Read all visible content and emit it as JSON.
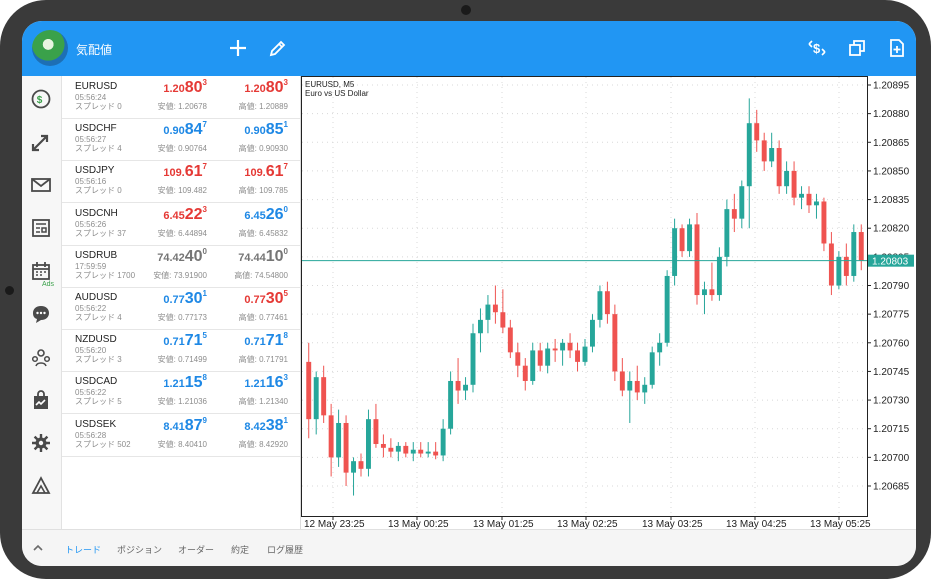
{
  "header": {
    "title": "気配値"
  },
  "quotes": [
    {
      "symbol": "EURUSD",
      "time": "05:56:24",
      "spread": "スプレッド 0",
      "bid": {
        "small": "1.20",
        "big": "80",
        "sup": "3",
        "color": "#e53935"
      },
      "ask": {
        "small": "1.20",
        "big": "80",
        "sup": "3",
        "color": "#e53935"
      },
      "low": "安値: 1.20678",
      "high": "高値: 1.20889"
    },
    {
      "symbol": "USDCHF",
      "time": "05:56:27",
      "spread": "スプレッド 4",
      "bid": {
        "small": "0.90",
        "big": "84",
        "sup": "7",
        "color": "#1e88e5"
      },
      "ask": {
        "small": "0.90",
        "big": "85",
        "sup": "1",
        "color": "#1e88e5"
      },
      "low": "安値: 0.90764",
      "high": "高値: 0.90930"
    },
    {
      "symbol": "USDJPY",
      "time": "05:56:16",
      "spread": "スプレッド 0",
      "bid": {
        "small": "109.",
        "big": "61",
        "sup": "7",
        "color": "#e53935"
      },
      "ask": {
        "small": "109.",
        "big": "61",
        "sup": "7",
        "color": "#e53935"
      },
      "low": "安値: 109.482",
      "high": "高値: 109.785"
    },
    {
      "symbol": "USDCNH",
      "time": "05:56:26",
      "spread": "スプレッド 37",
      "bid": {
        "small": "6.45",
        "big": "22",
        "sup": "3",
        "color": "#e53935"
      },
      "ask": {
        "small": "6.45",
        "big": "26",
        "sup": "0",
        "color": "#1e88e5"
      },
      "low": "安値: 6.44894",
      "high": "高値: 6.45832"
    },
    {
      "symbol": "USDRUB",
      "time": "17:59:59",
      "spread": "スプレッド 1700",
      "bid": {
        "small": "74.42",
        "big": "40",
        "sup": "0",
        "color": "#757575"
      },
      "ask": {
        "small": "74.44",
        "big": "10",
        "sup": "0",
        "color": "#757575"
      },
      "low": "安値: 73.91900",
      "high": "高値: 74.54800"
    },
    {
      "symbol": "AUDUSD",
      "time": "05:56:22",
      "spread": "スプレッド 4",
      "bid": {
        "small": "0.77",
        "big": "30",
        "sup": "1",
        "color": "#1e88e5"
      },
      "ask": {
        "small": "0.77",
        "big": "30",
        "sup": "5",
        "color": "#e53935"
      },
      "low": "安値: 0.77173",
      "high": "高値: 0.77461"
    },
    {
      "symbol": "NZDUSD",
      "time": "05:56:20",
      "spread": "スプレッド 3",
      "bid": {
        "small": "0.71",
        "big": "71",
        "sup": "5",
        "color": "#1e88e5"
      },
      "ask": {
        "small": "0.71",
        "big": "71",
        "sup": "8",
        "color": "#1e88e5"
      },
      "low": "安値: 0.71499",
      "high": "高値: 0.71791"
    },
    {
      "symbol": "USDCAD",
      "time": "05:56:22",
      "spread": "スプレッド 5",
      "bid": {
        "small": "1.21",
        "big": "15",
        "sup": "8",
        "color": "#1e88e5"
      },
      "ask": {
        "small": "1.21",
        "big": "16",
        "sup": "3",
        "color": "#1e88e5"
      },
      "low": "安値: 1.21036",
      "high": "高値: 1.21340"
    },
    {
      "symbol": "USDSEK",
      "time": "05:56:28",
      "spread": "スプレッド 502",
      "bid": {
        "small": "8.41",
        "big": "87",
        "sup": "9",
        "color": "#1e88e5"
      },
      "ask": {
        "small": "8.42",
        "big": "38",
        "sup": "1",
        "color": "#1e88e5"
      },
      "low": "安値: 8.40410",
      "high": "高値: 8.42920"
    }
  ],
  "rail": {
    "ads_label": "Ads"
  },
  "chart": {
    "symbol_label": "EURUSD, M5",
    "description": "Euro vs US Dollar",
    "price_labels": [
      "1.20895",
      "1.20880",
      "1.20865",
      "1.20850",
      "1.20835",
      "1.20820",
      "1.20805",
      "1.20790",
      "1.20775",
      "1.20760",
      "1.20745",
      "1.20730",
      "1.20715",
      "1.20700",
      "1.20685"
    ],
    "time_labels": [
      "12 May 23:25",
      "13 May 00:25",
      "13 May 01:25",
      "13 May 02:25",
      "13 May 03:25",
      "13 May 04:25",
      "13 May 05:25"
    ],
    "current_price": "1.20803",
    "bull_color": "#26a69a",
    "bear_color": "#ef5350",
    "candles": [
      [
        1.2075,
        1.2076,
        1.2071,
        1.2072
      ],
      [
        1.2072,
        1.20745,
        1.20712,
        1.20742
      ],
      [
        1.20742,
        1.20748,
        1.20718,
        1.20722
      ],
      [
        1.20722,
        1.20728,
        1.2069,
        1.207
      ],
      [
        1.207,
        1.20725,
        1.20695,
        1.20718
      ],
      [
        1.20718,
        1.20722,
        1.20685,
        1.20692
      ],
      [
        1.20692,
        1.207,
        1.2068,
        1.20698
      ],
      [
        1.20698,
        1.20702,
        1.2069,
        1.20694
      ],
      [
        1.20694,
        1.20725,
        1.2069,
        1.2072
      ],
      [
        1.2072,
        1.20728,
        1.20705,
        1.20707
      ],
      [
        1.20707,
        1.20712,
        1.207,
        1.20705
      ],
      [
        1.20705,
        1.2071,
        1.207,
        1.20703
      ],
      [
        1.20703,
        1.20708,
        1.20698,
        1.20706
      ],
      [
        1.20706,
        1.20708,
        1.207,
        1.20702
      ],
      [
        1.20702,
        1.20708,
        1.20698,
        1.20704
      ],
      [
        1.20704,
        1.20708,
        1.207,
        1.20702
      ],
      [
        1.20702,
        1.20708,
        1.207,
        1.20703
      ],
      [
        1.20703,
        1.20708,
        1.20699,
        1.20701
      ],
      [
        1.20701,
        1.2072,
        1.20698,
        1.20715
      ],
      [
        1.20715,
        1.20745,
        1.20712,
        1.2074
      ],
      [
        1.2074,
        1.20752,
        1.20728,
        1.20735
      ],
      [
        1.20735,
        1.20742,
        1.2073,
        1.20738
      ],
      [
        1.20738,
        1.2077,
        1.20734,
        1.20765
      ],
      [
        1.20765,
        1.20778,
        1.20755,
        1.20772
      ],
      [
        1.20772,
        1.20785,
        1.20765,
        1.2078
      ],
      [
        1.2078,
        1.2079,
        1.2077,
        1.20776
      ],
      [
        1.20776,
        1.20788,
        1.20765,
        1.20768
      ],
      [
        1.20768,
        1.20772,
        1.20752,
        1.20755
      ],
      [
        1.20755,
        1.2076,
        1.20742,
        1.20748
      ],
      [
        1.20748,
        1.20752,
        1.20735,
        1.2074
      ],
      [
        1.2074,
        1.2076,
        1.20738,
        1.20756
      ],
      [
        1.20756,
        1.2076,
        1.20745,
        1.20748
      ],
      [
        1.20748,
        1.2076,
        1.20744,
        1.20757
      ],
      [
        1.20757,
        1.20762,
        1.2075,
        1.20756
      ],
      [
        1.20756,
        1.20762,
        1.20748,
        1.2076
      ],
      [
        1.2076,
        1.20765,
        1.20752,
        1.20756
      ],
      [
        1.20756,
        1.2076,
        1.20745,
        1.2075
      ],
      [
        1.2075,
        1.20762,
        1.20748,
        1.20758
      ],
      [
        1.20758,
        1.20775,
        1.20755,
        1.20772
      ],
      [
        1.20772,
        1.2079,
        1.20768,
        1.20787
      ],
      [
        1.20787,
        1.20792,
        1.2077,
        1.20775
      ],
      [
        1.20775,
        1.2078,
        1.2074,
        1.20745
      ],
      [
        1.20745,
        1.20752,
        1.20732,
        1.20735
      ],
      [
        1.20735,
        1.20745,
        1.20718,
        1.2074
      ],
      [
        1.2074,
        1.20748,
        1.2073,
        1.20734
      ],
      [
        1.20734,
        1.20742,
        1.20728,
        1.20738
      ],
      [
        1.20738,
        1.20758,
        1.20736,
        1.20755
      ],
      [
        1.20755,
        1.20765,
        1.20748,
        1.2076
      ],
      [
        1.2076,
        1.20798,
        1.20758,
        1.20795
      ],
      [
        1.20795,
        1.20825,
        1.2079,
        1.2082
      ],
      [
        1.2082,
        1.20822,
        1.20805,
        1.20808
      ],
      [
        1.20808,
        1.20825,
        1.20805,
        1.20822
      ],
      [
        1.20822,
        1.20828,
        1.2078,
        1.20785
      ],
      [
        1.20785,
        1.20792,
        1.20775,
        1.20788
      ],
      [
        1.20788,
        1.20802,
        1.20782,
        1.20785
      ],
      [
        1.20785,
        1.2081,
        1.20782,
        1.20805
      ],
      [
        1.20805,
        1.20835,
        1.208,
        1.2083
      ],
      [
        1.2083,
        1.20838,
        1.20818,
        1.20825
      ],
      [
        1.20825,
        1.20845,
        1.2082,
        1.20842
      ],
      [
        1.20842,
        1.20888,
        1.2082,
        1.20875
      ],
      [
        1.20875,
        1.20882,
        1.2086,
        1.20866
      ],
      [
        1.20866,
        1.2087,
        1.2085,
        1.20855
      ],
      [
        1.20855,
        1.2087,
        1.20852,
        1.20862
      ],
      [
        1.20862,
        1.20866,
        1.20838,
        1.20842
      ],
      [
        1.20842,
        1.20855,
        1.20838,
        1.2085
      ],
      [
        1.2085,
        1.20855,
        1.20832,
        1.20836
      ],
      [
        1.20836,
        1.20842,
        1.2083,
        1.20838
      ],
      [
        1.20838,
        1.20842,
        1.20828,
        1.20832
      ],
      [
        1.20832,
        1.20838,
        1.20825,
        1.20834
      ],
      [
        1.20834,
        1.20836,
        1.20808,
        1.20812
      ],
      [
        1.20812,
        1.20818,
        1.20785,
        1.2079
      ],
      [
        1.2079,
        1.20808,
        1.20788,
        1.20805
      ],
      [
        1.20805,
        1.20812,
        1.2079,
        1.20795
      ],
      [
        1.20795,
        1.20822,
        1.20792,
        1.20818
      ],
      [
        1.20818,
        1.20822,
        1.20798,
        1.20803
      ]
    ]
  },
  "bottom_tabs": [
    {
      "label": "トレード",
      "active": true
    },
    {
      "label": "ポジション",
      "active": false
    },
    {
      "label": "オーダー",
      "active": false
    },
    {
      "label": "約定",
      "active": false
    },
    {
      "label": "ログ履歴",
      "active": false
    }
  ]
}
